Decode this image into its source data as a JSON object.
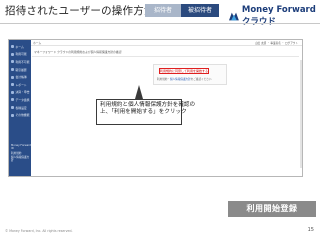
{
  "header": {
    "title": "招待されたユーザーの操作方法",
    "step_tag_1": "招待者",
    "step_tag_2": "被招待者",
    "logo_text": "Money Forward クラウド",
    "logo_color": "#1c3d7a"
  },
  "app": {
    "sidebar_color": "#2a4d88",
    "sidebar": [
      {
        "label": "ホーム",
        "icon": "home-icon"
      },
      {
        "label": "利用可能",
        "icon": "folder-icon"
      },
      {
        "label": "利用不可能",
        "icon": "folder-icon"
      },
      {
        "label": "取引履歴",
        "icon": "list-icon"
      },
      {
        "label": "会計帳簿",
        "icon": "book-icon"
      },
      {
        "label": "レポート",
        "icon": "chart-icon"
      },
      {
        "label": "決算・申告",
        "icon": "document-icon"
      },
      {
        "label": "データ連携",
        "icon": "link-icon"
      },
      {
        "label": "各種設定",
        "icon": "gear-icon"
      },
      {
        "label": "その他機能",
        "icon": "menu-icon"
      }
    ],
    "sidebar_footer": [
      "Money Forward ID",
      "利用規約",
      "個人情報保護方針"
    ],
    "top_left": "ホーム",
    "top_right": "山田 太郎 ・ 事業者名 ・ ログアウト",
    "breadcrumb": "マネーフォワード クラウドの利用規約および個人情報保護方針の確認",
    "start_button": "利用規約に同意して利用を開始する",
    "card_note_prefix": "利用規約",
    "card_note_link": "個人情報保護方針",
    "card_note_suffix": "をご確認ください"
  },
  "callout": {
    "line1": "利用規約と個人情報保護方針を確認の",
    "line2": "上、「利用を開始する」をクリック"
  },
  "footer": {
    "badge": "利用開始登録",
    "badge_color": "#8a8a8a",
    "copyright": "© Money Forward, Inc. All rights reserved.",
    "page_number": "15"
  }
}
